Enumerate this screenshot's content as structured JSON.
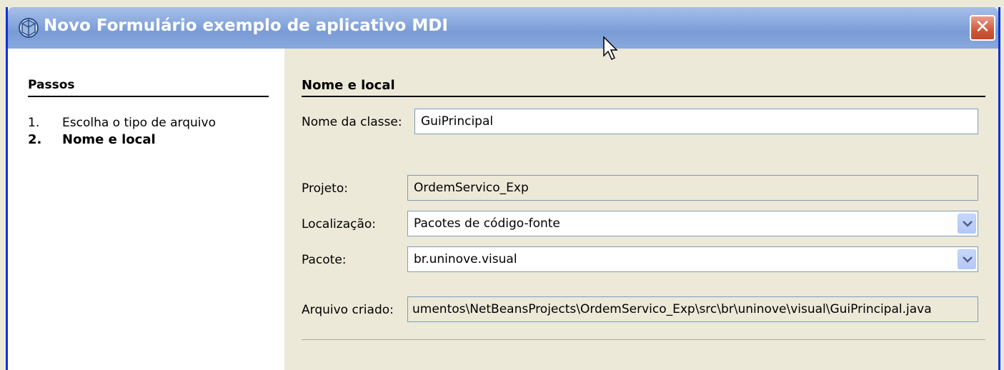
{
  "window": {
    "title": "Novo Formulário exemplo de aplicativo MDI"
  },
  "steps": {
    "title": "Passos",
    "items": [
      {
        "num": "1.",
        "label": "Escolha o tipo de arquivo"
      },
      {
        "num": "2.",
        "label": "Nome e local"
      }
    ]
  },
  "form": {
    "section_title": "Nome e local",
    "class_name": {
      "label": "Nome da classe:",
      "value": "GuiPrincipal"
    },
    "project": {
      "label": "Projeto:",
      "value": "OrdemServico_Exp"
    },
    "location": {
      "label": "Localização:",
      "value": "Pacotes de código-fonte"
    },
    "package": {
      "label": "Pacote:",
      "value": "br.uninove.visual"
    },
    "created_file": {
      "label": "Arquivo criado:",
      "value": "umentos\\NetBeansProjects\\OrdemServico_Exp\\src\\br\\uninove\\visual\\GuiPrincipal.java"
    }
  }
}
